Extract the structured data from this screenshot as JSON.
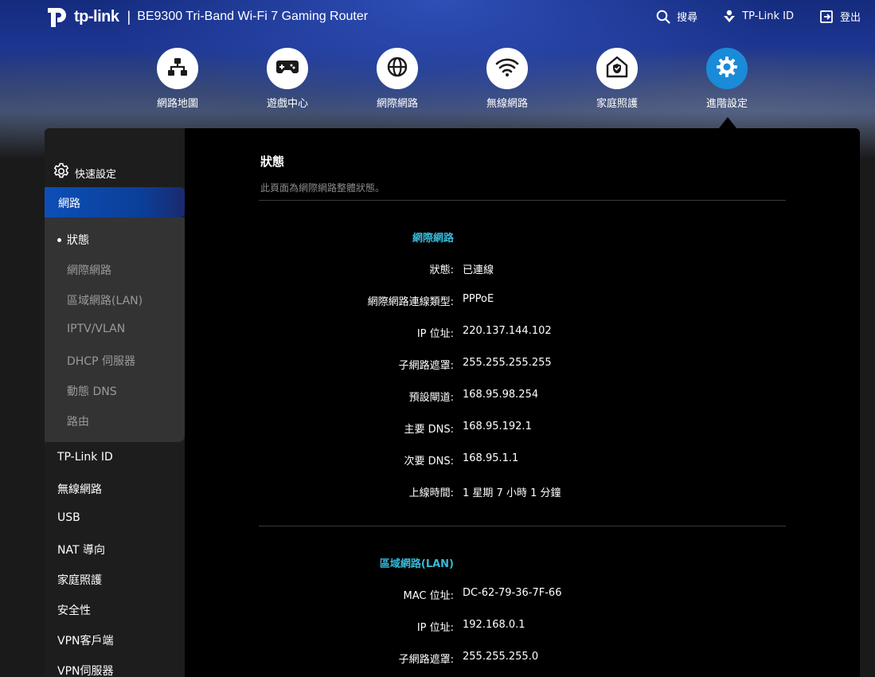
{
  "header": {
    "brand": "tp-link",
    "separator": "|",
    "model": "BE9300 Tri-Band Wi-Fi 7 Gaming Router",
    "actions": [
      {
        "label": "搜尋",
        "icon": "search-icon"
      },
      {
        "label": "TP-Link ID",
        "icon": "tplink-id-icon"
      },
      {
        "label": "登出",
        "icon": "logout-icon"
      }
    ]
  },
  "nav": {
    "items": [
      {
        "label": "網路地圖",
        "icon": "network-map-icon"
      },
      {
        "label": "遊戲中心",
        "icon": "gamepad-icon"
      },
      {
        "label": "網際網路",
        "icon": "globe-icon"
      },
      {
        "label": "無線網路",
        "icon": "wifi-icon"
      },
      {
        "label": "家庭照護",
        "icon": "home-shield-icon"
      },
      {
        "label": "進階設定",
        "icon": "advanced-gear-icon",
        "active": true
      }
    ]
  },
  "sidebar": {
    "quick_setup": "快速設定",
    "active_section": "網路",
    "sub_items": [
      "狀態",
      "網際網路",
      "區域網路(LAN)",
      "IPTV/VLAN",
      "DHCP 伺服器",
      "動態 DNS",
      "路由"
    ],
    "current_sub": "狀態",
    "items": [
      "TP-Link ID",
      "無線網路",
      "USB",
      "NAT 導向",
      "家庭照護",
      "安全性",
      "VPN客戶端",
      "VPN伺服器"
    ]
  },
  "page": {
    "title": "狀態",
    "description": "此頁面為網際網路整體狀態。"
  },
  "internet": {
    "title": "網際網路",
    "rows": [
      {
        "label": "狀態:",
        "value": "已連線"
      },
      {
        "label": "網際網路連線類型:",
        "value": "PPPoE"
      },
      {
        "label": "IP 位址:",
        "value": "220.137.144.102"
      },
      {
        "label": "子網路遮罩:",
        "value": "255.255.255.255"
      },
      {
        "label": "預設閘道:",
        "value": "168.95.98.254"
      },
      {
        "label": "主要 DNS:",
        "value": "168.95.192.1"
      },
      {
        "label": "次要 DNS:",
        "value": "168.95.1.1"
      },
      {
        "label": "上線時間:",
        "value": "1 星期 7 小時 1 分鐘"
      }
    ]
  },
  "lan": {
    "title": "區域網路(LAN)",
    "rows": [
      {
        "label": "MAC 位址:",
        "value": "DC-62-79-36-7F-66"
      },
      {
        "label": "IP 位址:",
        "value": "192.168.0.1"
      },
      {
        "label": "子網路遮罩:",
        "value": "255.255.255.0"
      }
    ]
  },
  "colors": {
    "accent": "#36b9d8",
    "active_nav": "#1a8bd8",
    "sidebar_active": "#0d4fb7"
  }
}
